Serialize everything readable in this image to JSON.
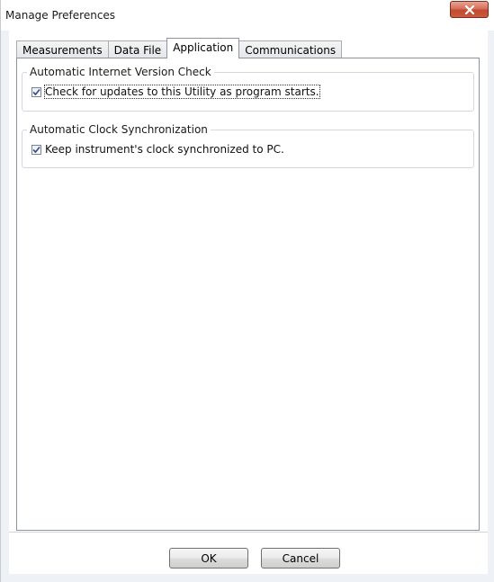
{
  "window": {
    "title": "Manage Preferences",
    "close_icon": "close-icon"
  },
  "tabs": [
    {
      "label": "Measurements",
      "active": false
    },
    {
      "label": "Data File",
      "active": false
    },
    {
      "label": "Application",
      "active": true
    },
    {
      "label": "Communications",
      "active": false
    }
  ],
  "groups": {
    "internet_check": {
      "title": "Automatic Internet Version Check",
      "checkbox_label": "Check for updates to this Utility as program starts.",
      "checked": true
    },
    "clock_sync": {
      "title": "Automatic Clock Synchronization",
      "checkbox_label": "Keep instrument's clock synchronized to PC.",
      "checked": true
    }
  },
  "buttons": {
    "ok_label": "OK",
    "cancel_label": "Cancel"
  },
  "colors": {
    "close_button": "#c7503a",
    "checkmark": "#2c4a8c"
  }
}
